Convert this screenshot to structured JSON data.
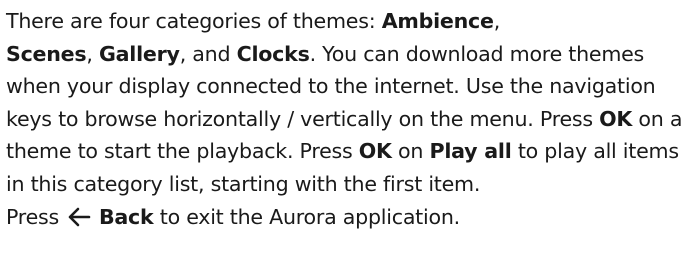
{
  "paragraph1": {
    "s1": "There are four categories of themes: ",
    "kw_ambience": "Ambience",
    "s2": ",",
    "kw_scenes": "Scenes",
    "s3": ", ",
    "kw_gallery": "Gallery",
    "s4": ", and ",
    "kw_clocks": "Clocks",
    "s5": ". You can download more themes when your display connected to the internet. Use the navigation keys to browse horizontally / vertically on the menu. Press ",
    "kw_ok1": "OK",
    "s6": " on a theme to start the playback. Press ",
    "kw_ok2": "OK",
    "s7": " on ",
    "kw_play_all": "Play all",
    "s8": " to play all items in this category list, starting with the first item."
  },
  "paragraph2": {
    "press": "Press",
    "back_icon": "left-arrow-icon",
    "kw_back": "Back",
    "rest": " to exit the Aurora application."
  }
}
